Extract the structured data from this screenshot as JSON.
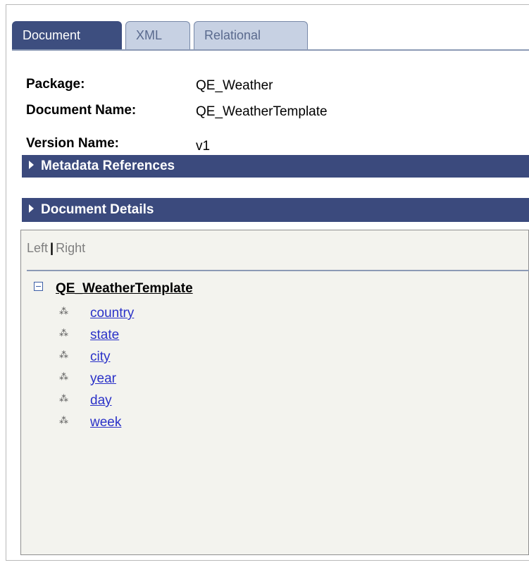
{
  "tabs": [
    {
      "label": "Document",
      "active": true
    },
    {
      "label": "XML",
      "active": false
    },
    {
      "label": "Relational",
      "active": false
    }
  ],
  "fields": {
    "package_label": "Package:",
    "package_value": "QE_Weather",
    "document_name_label": "Document Name:",
    "document_name_value": "QE_WeatherTemplate",
    "version_name_label": "Version Name:",
    "version_name_value": "v1"
  },
  "sections": {
    "metadata_references": "Metadata References",
    "document_details": "Document Details"
  },
  "panel": {
    "left_label": "Left",
    "separator": "|",
    "right_label": "Right",
    "tree": {
      "root": "QE_WeatherTemplate",
      "children": [
        "country",
        "state",
        "city",
        "year",
        "day",
        "week"
      ]
    }
  },
  "colors": {
    "tab_active": "#3d4e7f",
    "tab_inactive": "#c7d1e3",
    "section_bar": "#3b4a7d",
    "panel_bg": "#f3f3ee",
    "link": "#2b32c8"
  }
}
